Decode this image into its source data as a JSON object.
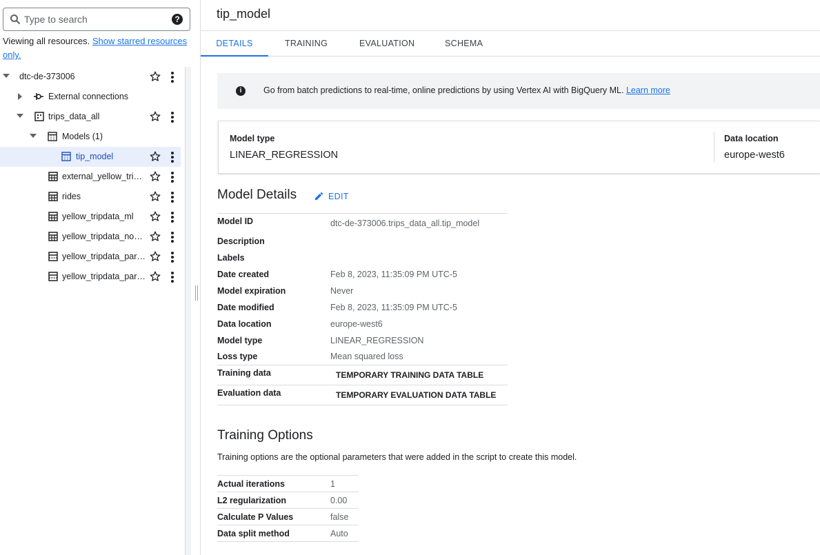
{
  "search": {
    "placeholder": "Type to search"
  },
  "explorer": {
    "viewing_text": "Viewing all resources.",
    "starred_link": "Show starred resources only.",
    "items": [
      {
        "label": "dtc-de-373006"
      },
      {
        "label": "External connections"
      },
      {
        "label": "trips_data_all"
      },
      {
        "label": "Models (1)"
      },
      {
        "label": "tip_model"
      },
      {
        "label": "external_yellow_tripd…"
      },
      {
        "label": "rides"
      },
      {
        "label": "yellow_tripdata_ml"
      },
      {
        "label": "yellow_tripdata_non_…"
      },
      {
        "label": "yellow_tripdata_parti…"
      },
      {
        "label": "yellow_tripdata_parti…"
      }
    ]
  },
  "main": {
    "title": "tip_model",
    "tabs": [
      {
        "label": "DETAILS"
      },
      {
        "label": "TRAINING"
      },
      {
        "label": "EVALUATION"
      },
      {
        "label": "SCHEMA"
      }
    ],
    "banner": {
      "text": "Go from batch predictions to real-time, online predictions by using Vertex AI with BigQuery ML.",
      "link": "Learn more"
    },
    "summary": {
      "model_type_label": "Model type",
      "model_type_value": "LINEAR_REGRESSION",
      "data_location_label": "Data location",
      "data_location_value": "europe-west6"
    },
    "model_details": {
      "heading": "Model Details",
      "edit_label": "EDIT",
      "rows": [
        {
          "k": "Model ID",
          "v": "dtc-de-373006.trips_data_all.tip_model"
        },
        {
          "k": "Description",
          "v": ""
        },
        {
          "k": "Labels",
          "v": ""
        },
        {
          "k": "Date created",
          "v": "Feb 8, 2023, 11:35:09 PM UTC-5"
        },
        {
          "k": "Model expiration",
          "v": "Never"
        },
        {
          "k": "Date modified",
          "v": "Feb 8, 2023, 11:35:09 PM UTC-5"
        },
        {
          "k": "Data location",
          "v": "europe-west6"
        },
        {
          "k": "Model type",
          "v": "LINEAR_REGRESSION"
        },
        {
          "k": "Loss type",
          "v": "Mean squared loss"
        },
        {
          "k": "Training data",
          "v": "TEMPORARY TRAINING DATA TABLE"
        },
        {
          "k": "Evaluation data",
          "v": "TEMPORARY EVALUATION DATA TABLE"
        }
      ]
    },
    "training_options": {
      "heading": "Training Options",
      "description": "Training options are the optional parameters that were added in the script to create this model.",
      "rows": [
        {
          "k": "Actual iterations",
          "v": "1"
        },
        {
          "k": "L2 regularization",
          "v": "0.00"
        },
        {
          "k": "Calculate P Values",
          "v": "false"
        },
        {
          "k": "Data split method",
          "v": "Auto"
        }
      ]
    }
  },
  "colors": {
    "accent": "#1a73e8",
    "selected_row": "#e8eefc",
    "banner_bg": "#f1f3f4"
  }
}
